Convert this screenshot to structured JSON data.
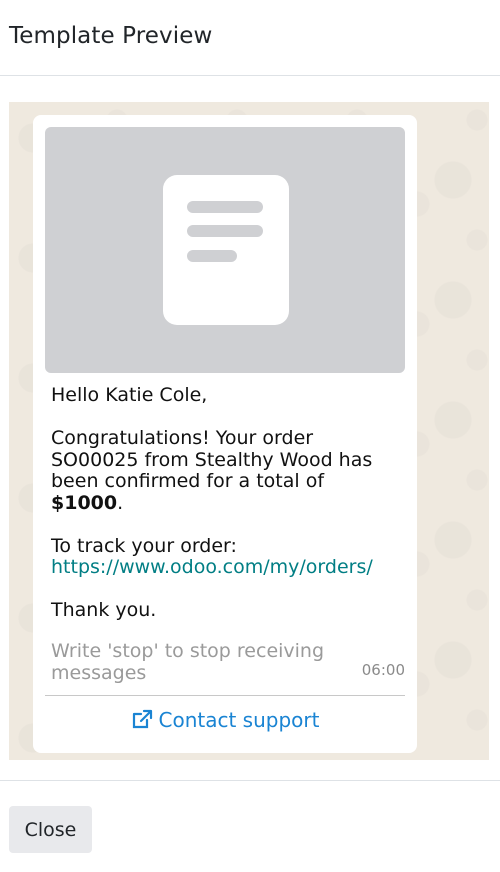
{
  "dialog": {
    "title": "Template Preview",
    "close_label": "Close"
  },
  "preview": {
    "media_icon": "document-icon",
    "greeting": "Hello Katie Cole,",
    "body_line_1": "Congratulations! Your order SO00025 from Stealthy Wood has been confirmed for a total of ",
    "total": "$1000",
    "body_line_end": ".",
    "track_label": "To track your order:",
    "track_link": "https://www.odoo.com/my/orders/",
    "thanks": "Thank you.",
    "footer": "Write 'stop' to stop receiving messages",
    "time": "06:00",
    "button_label": "Contact support",
    "button_icon": "external-link-icon"
  },
  "colors": {
    "link": "#017e84",
    "button_text": "#1a84d3",
    "chat_background": "#efe9df"
  }
}
